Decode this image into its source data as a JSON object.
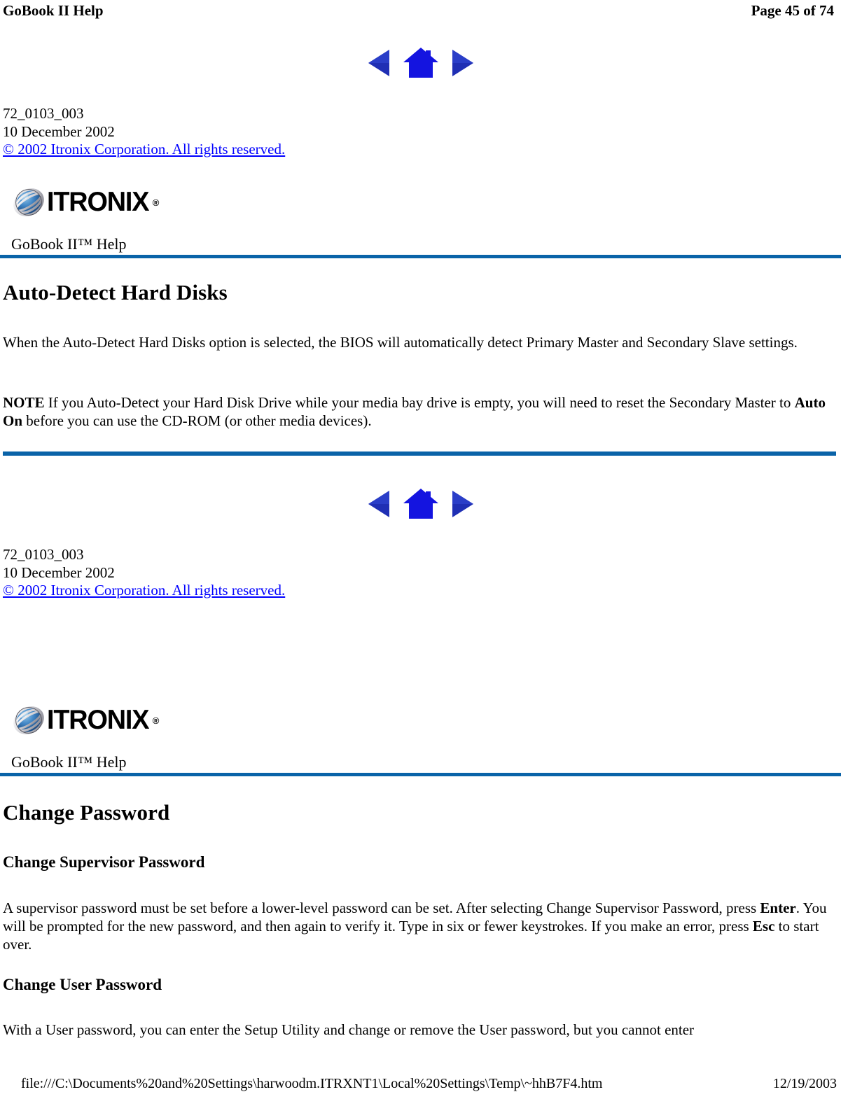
{
  "header": {
    "title": "GoBook II Help",
    "page_indicator": "Page 45 of 74"
  },
  "nav": {
    "back_icon": "left-triangle-icon",
    "home_icon": "house-icon",
    "forward_icon": "right-triangle-icon"
  },
  "doc_info": {
    "doc_id": "72_0103_003",
    "date": "10 December 2002",
    "copyright": "© 2002 Itronix Corporation.  All rights reserved."
  },
  "brand": {
    "globe_icon": "globe-icon",
    "wordmark": "ITRONIX",
    "registered": "®",
    "help_label": "GoBook II™ Help"
  },
  "sections": {
    "auto_detect": {
      "heading": "Auto-Detect Hard Disks",
      "intro_paragraph": "When the Auto-Detect Hard Disks option is selected, the BIOS will automatically detect Primary Master and Secondary Slave settings.",
      "note_label": "NOTE",
      "note_part1": "  If you Auto-Detect your Hard Disk Drive while your media bay drive is empty, you will need to reset the Secondary Master to ",
      "note_emphasis": "Auto On",
      "note_part2": " before you can use the CD-ROM (or other media devices)."
    },
    "change_password": {
      "heading": "Change Password",
      "supervisor": {
        "heading": "Change Supervisor Password",
        "part1": "A supervisor password must be set before a lower-level password can be set.  After selecting Change Supervisor Password, press ",
        "key1": "Enter",
        "part2": ".  You will be prompted for the new password, and then again to verify it.  Type in six or fewer keystrokes.  If you make an error, press ",
        "key2": "Esc",
        "part3": " to start over."
      },
      "user": {
        "heading": "Change User Password",
        "paragraph": "With a User password, you can enter the Setup Utility and change or remove the User password, but you cannot enter"
      }
    }
  },
  "footer": {
    "file_path": "file:///C:\\Documents%20and%20Settings\\harwoodm.ITRXNT1\\Local%20Settings\\Temp\\~hhB7F4.htm",
    "date": "12/19/2003"
  },
  "colors": {
    "rule_blue": "#0a63a8",
    "link_blue": "#0000ff",
    "nav_blue": "#1a1ae6"
  }
}
